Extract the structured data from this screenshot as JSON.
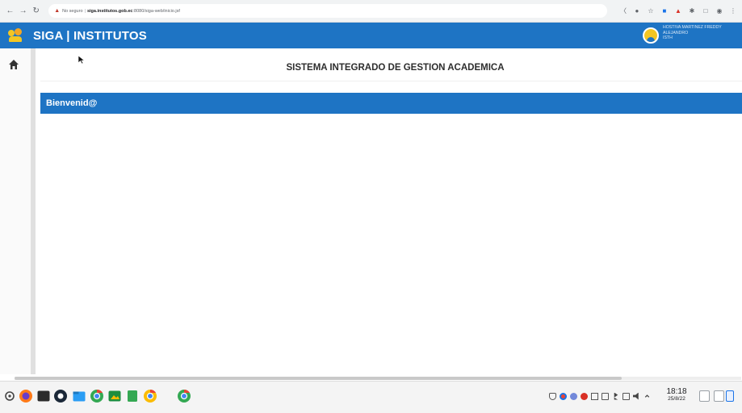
{
  "browser": {
    "security_text": "No seguro",
    "url_host": "siga.institutos.gob.ec",
    "url_path": ":8080/siga-web/inicio.jsf"
  },
  "app": {
    "title": "SIGA | INSTITUTOS",
    "user_lines": [
      "HOSTIVA MARTINEZ FREDDY",
      "ALEJANDRO",
      "ISTH"
    ]
  },
  "main": {
    "page_title": "SISTEMA INTEGRADO DE GESTION ACADEMICA",
    "welcome_label": "Bienvenid@"
  },
  "taskbar": {
    "time": "18:18",
    "date": "25/8/22"
  },
  "colors": {
    "header_blue": "#1e74c4",
    "logo_yellow": "#f3c623"
  },
  "icons": {
    "home": "home-icon",
    "back": "back-arrow-icon",
    "forward": "forward-arrow-icon",
    "reload": "reload-icon",
    "warning": "warning-icon"
  }
}
